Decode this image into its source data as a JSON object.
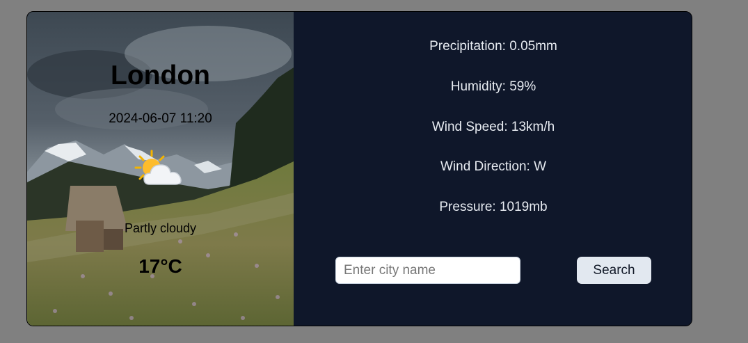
{
  "location": {
    "city": "London",
    "datetime": "2024-06-07 11:20"
  },
  "current": {
    "icon": "partly-cloudy-icon",
    "condition": "Partly cloudy",
    "temperature": "17°C"
  },
  "details": {
    "precipitation": "Precipitation: 0.05mm",
    "humidity": "Humidity: 59%",
    "wind_speed": "Wind Speed: 13km/h",
    "wind_direction": "Wind Direction: W",
    "pressure": "Pressure: 1019mb"
  },
  "search": {
    "placeholder": "Enter city name",
    "value": "",
    "button_label": "Search"
  },
  "colors": {
    "page_background": "#808080",
    "panel_background": "#0f172a",
    "button_background": "#e2e8f0"
  }
}
